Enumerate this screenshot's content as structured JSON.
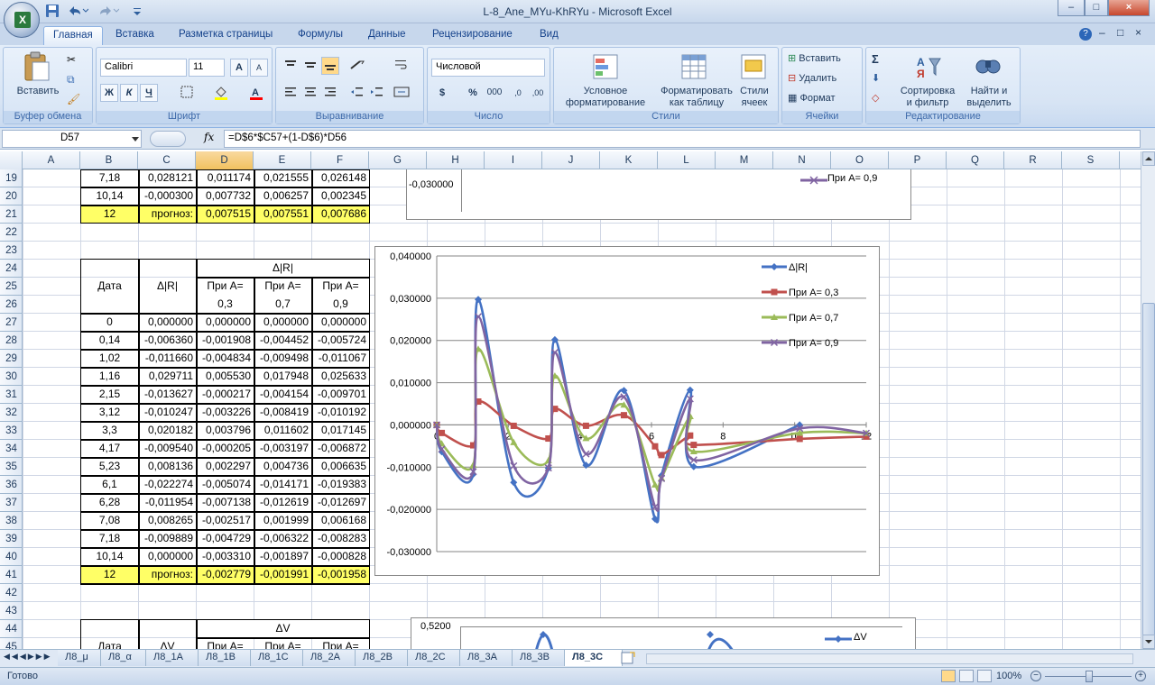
{
  "window": {
    "title": "L-8_Ane_MYu-KhRYu - Microsoft Excel",
    "controls": [
      "–",
      "□",
      "×"
    ],
    "ribbon_controls": [
      "–",
      "□",
      "×"
    ],
    "app_initial": "X"
  },
  "ribbon": {
    "tabs": [
      "Главная",
      "Вставка",
      "Разметка страницы",
      "Формулы",
      "Данные",
      "Рецензирование",
      "Вид"
    ],
    "active_tab": "Главная",
    "clipboard": {
      "label": "Буфер обмена",
      "paste": "Вставить"
    },
    "font": {
      "label": "Шрифт",
      "family": "Calibri",
      "size": "11",
      "bold": "Ж",
      "italic": "К",
      "underline": "Ч",
      "grow": "A",
      "shrink": "A",
      "color": "A"
    },
    "alignment": {
      "label": "Выравнивание"
    },
    "number": {
      "label": "Число",
      "format": "Числовой",
      "currency": "$",
      "percent": "%",
      "thousands": "000",
      "inc_decimal": ",0",
      "dec_decimal": ",00"
    },
    "styles": {
      "label": "Стили",
      "conditional": [
        "Условное",
        "форматирование"
      ],
      "as_table": [
        "Форматировать",
        "как таблицу"
      ],
      "cell_styles": [
        "Стили",
        "ячеек"
      ]
    },
    "cells": {
      "label": "Ячейки",
      "insert": "Вставить",
      "delete": "Удалить",
      "format": "Формат"
    },
    "editing": {
      "label": "Редактирование",
      "sum": "Σ",
      "sort_filter": [
        "Сортировка",
        "и фильтр"
      ],
      "find": [
        "Найти и",
        "выделить"
      ]
    }
  },
  "formula_bar": {
    "name_box": "D57",
    "fx": "fx",
    "formula": "=D$6*$C57+(1-D$6)*D56"
  },
  "columns": [
    "A",
    "B",
    "C",
    "D",
    "E",
    "F",
    "G",
    "H",
    "I",
    "J",
    "K",
    "L",
    "M",
    "N",
    "O",
    "P",
    "Q",
    "R",
    "S"
  ],
  "selected_column": "D",
  "rows": [
    "19",
    "20",
    "21",
    "22",
    "23",
    "24",
    "25",
    "26",
    "27",
    "28",
    "29",
    "30",
    "31",
    "32",
    "33",
    "34",
    "35",
    "36",
    "37",
    "38",
    "39",
    "40",
    "41",
    "42",
    "43",
    "44",
    "45"
  ],
  "table_top": {
    "rows": [
      [
        "7,18",
        "0,028121",
        "0,011174",
        "0,021555",
        "0,026148"
      ],
      [
        "10,14",
        "-0,000300",
        "0,007732",
        "0,006257",
        "0,002345"
      ]
    ],
    "forecast": [
      "12",
      "прогноз:",
      "0,007515",
      "0,007551",
      "0,007686"
    ]
  },
  "table_r": {
    "group_header": "Δ|R|",
    "col_date": "Дата",
    "col_delta": "Δ|R|",
    "col_a1": [
      "При А=",
      "0,3"
    ],
    "col_a2": [
      "При А=",
      "0,7"
    ],
    "col_a3": [
      "При А=",
      "0,9"
    ],
    "rows": [
      [
        "0",
        "0,000000",
        "0,000000",
        "0,000000",
        "0,000000"
      ],
      [
        "0,14",
        "-0,006360",
        "-0,001908",
        "-0,004452",
        "-0,005724"
      ],
      [
        "1,02",
        "-0,011660",
        "-0,004834",
        "-0,009498",
        "-0,011067"
      ],
      [
        "1,16",
        "0,029711",
        "0,005530",
        "0,017948",
        "0,025633"
      ],
      [
        "2,15",
        "-0,013627",
        "-0,000217",
        "-0,004154",
        "-0,009701"
      ],
      [
        "3,12",
        "-0,010247",
        "-0,003226",
        "-0,008419",
        "-0,010192"
      ],
      [
        "3,3",
        "0,020182",
        "0,003796",
        "0,011602",
        "0,017145"
      ],
      [
        "4,17",
        "-0,009540",
        "-0,000205",
        "-0,003197",
        "-0,006872"
      ],
      [
        "5,23",
        "0,008136",
        "0,002297",
        "0,004736",
        "0,006635"
      ],
      [
        "6,1",
        "-0,022274",
        "-0,005074",
        "-0,014171",
        "-0,019383"
      ],
      [
        "6,28",
        "-0,011954",
        "-0,007138",
        "-0,012619",
        "-0,012697"
      ],
      [
        "7,08",
        "0,008265",
        "-0,002517",
        "0,001999",
        "0,006168"
      ],
      [
        "7,18",
        "-0,009889",
        "-0,004729",
        "-0,006322",
        "-0,008283"
      ],
      [
        "10,14",
        "0,000000",
        "-0,003310",
        "-0,001897",
        "-0,000828"
      ]
    ],
    "forecast": [
      "12",
      "прогноз:",
      "-0,002779",
      "-0,001991",
      "-0,001958"
    ]
  },
  "table_v": {
    "group_header": "ΔV",
    "col_date": "Дата",
    "col_delta": "ΔV",
    "col_a1": "При А=",
    "col_a2": "При А=",
    "col_a3": "При А="
  },
  "chart_top": {
    "ytick": "-0,030000",
    "legend": "При А= 0,9"
  },
  "chart_v": {
    "ytick": "0,5200",
    "legend": "ΔV"
  },
  "chart_data": {
    "type": "line",
    "yticks": [
      "0,040000",
      "0,030000",
      "0,020000",
      "0,010000",
      "0,000000",
      "-0,010000",
      "-0,020000",
      "-0,030000"
    ],
    "xticks": [
      "0",
      "2",
      "4",
      "6",
      "8",
      "10",
      "12"
    ],
    "ylim": [
      -0.03,
      0.04
    ],
    "xlim": [
      0,
      12
    ],
    "x": [
      0,
      0.14,
      1.02,
      1.16,
      2.15,
      3.12,
      3.3,
      4.17,
      5.23,
      6.1,
      6.28,
      7.08,
      7.18,
      10.14,
      12
    ],
    "series": [
      {
        "name": "Δ|R|",
        "color": "#4472c4",
        "marker": "diamond",
        "x": [
          0,
          0.14,
          1.02,
          1.16,
          2.15,
          3.12,
          3.3,
          4.17,
          5.23,
          6.1,
          6.28,
          7.08,
          7.18,
          10.14
        ],
        "values": [
          0,
          -0.00636,
          -0.01166,
          0.029711,
          -0.013627,
          -0.010247,
          0.020182,
          -0.00954,
          0.008136,
          -0.022274,
          -0.011954,
          0.008265,
          -0.009889,
          0
        ]
      },
      {
        "name": "При А= 0,3",
        "color": "#c0504d",
        "marker": "square",
        "values": [
          0,
          -0.001908,
          -0.004834,
          0.00553,
          -0.000217,
          -0.003226,
          0.003796,
          -0.000205,
          0.002297,
          -0.005074,
          -0.007138,
          -0.002517,
          -0.004729,
          -0.00331,
          -0.002779
        ]
      },
      {
        "name": "При А= 0,7",
        "color": "#9bbb59",
        "marker": "triangle",
        "values": [
          0,
          -0.004452,
          -0.009498,
          0.017948,
          -0.004154,
          -0.008419,
          0.011602,
          -0.003197,
          0.004736,
          -0.014171,
          -0.012619,
          0.001999,
          -0.006322,
          -0.001897,
          -0.001991
        ]
      },
      {
        "name": "При А= 0,9",
        "color": "#8064a2",
        "marker": "x",
        "values": [
          0,
          -0.005724,
          -0.011067,
          0.025633,
          -0.009701,
          -0.010192,
          0.017145,
          -0.006872,
          0.006635,
          -0.019383,
          -0.012697,
          0.006168,
          -0.008283,
          -0.000828,
          -0.001958
        ]
      }
    ]
  },
  "sheet_tabs": [
    "Л8_μ",
    "Л8_α",
    "Л8_1А",
    "Л8_1В",
    "Л8_1С",
    "Л8_2А",
    "Л8_2В",
    "Л8_2С",
    "Л8_3А",
    "Л8_3В",
    "Л8_3С"
  ],
  "active_sheet": "Л8_3С",
  "status": {
    "ready": "Готово",
    "zoom": "100%"
  }
}
